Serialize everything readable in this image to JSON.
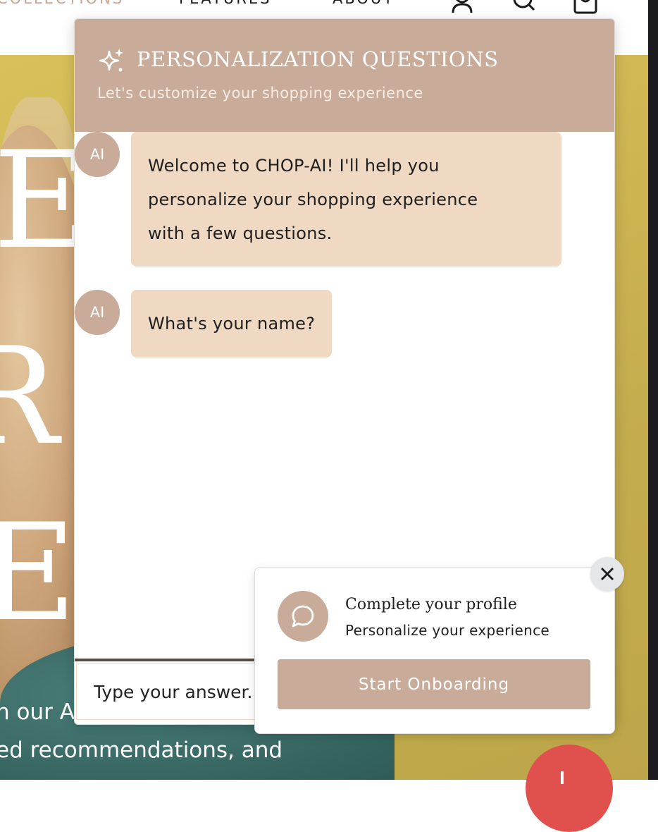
{
  "nav": {
    "collections": "COLLECTIONS",
    "features": "FEATURES",
    "about": "ABOUT",
    "icons": [
      "user-icon",
      "search-icon",
      "bag-icon"
    ]
  },
  "hero": {
    "letters": [
      "E",
      "R",
      "E"
    ],
    "line1": "h our AI-powered p",
    "line2": "ed recommendations, and"
  },
  "chat": {
    "title": "PERSONALIZATION QUESTIONS",
    "subtitle": "Let's customize your shopping experience",
    "messages": [
      {
        "avatar": "AI",
        "text": "Welcome to CHOP-AI! I'll help you\npersonalize your shopping experience\nwith a few questions."
      },
      {
        "avatar": "AI",
        "text": "What's your name?"
      }
    ],
    "input_placeholder": "Type your answer..."
  },
  "onboarding": {
    "title": "Complete your profile",
    "subtitle": "Personalize your experience",
    "button_label": "Start Onboarding"
  },
  "colors": {
    "accent": "#c8ab98",
    "bubble": "#f0d9c3",
    "hero_bg": "#cdb553",
    "fab": "#e0514e"
  }
}
